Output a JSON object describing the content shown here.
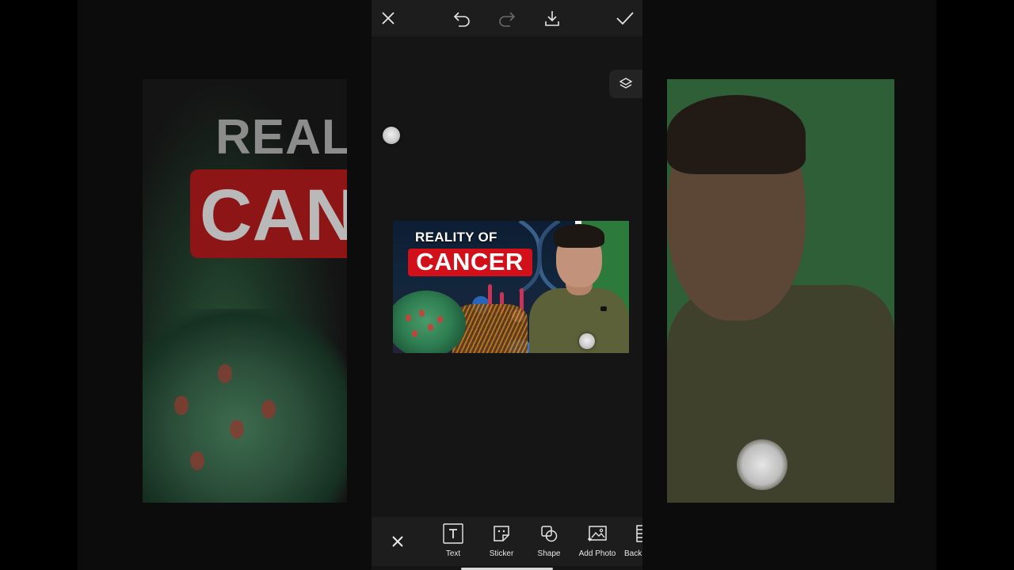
{
  "backdrop": {
    "left_title_line1": "REALIT",
    "left_title_line2": "CAN"
  },
  "topbar": {
    "close_icon": "close-icon",
    "undo_icon": "undo-icon",
    "redo_icon": "redo-icon",
    "download_icon": "download-icon",
    "apply_icon": "checkmark-icon"
  },
  "canvas": {
    "layers_icon": "layers-icon",
    "thumbnail": {
      "title_line1": "REALITY OF",
      "title_line2": "CANCER",
      "banner_color": "#d1101a"
    }
  },
  "toolbar": {
    "cancel_icon": "close-icon",
    "tools": [
      {
        "label": "Text",
        "icon": "text-icon"
      },
      {
        "label": "Sticker",
        "icon": "sticker-icon"
      },
      {
        "label": "Shape",
        "icon": "shape-icon"
      },
      {
        "label": "Add Photo",
        "icon": "add-photo-icon"
      },
      {
        "label": "Back",
        "icon": "background-icon"
      }
    ]
  },
  "colors": {
    "panel_bg": "#151515",
    "bar_bg": "#1d1d1d",
    "icon": "#e6e6e6"
  }
}
